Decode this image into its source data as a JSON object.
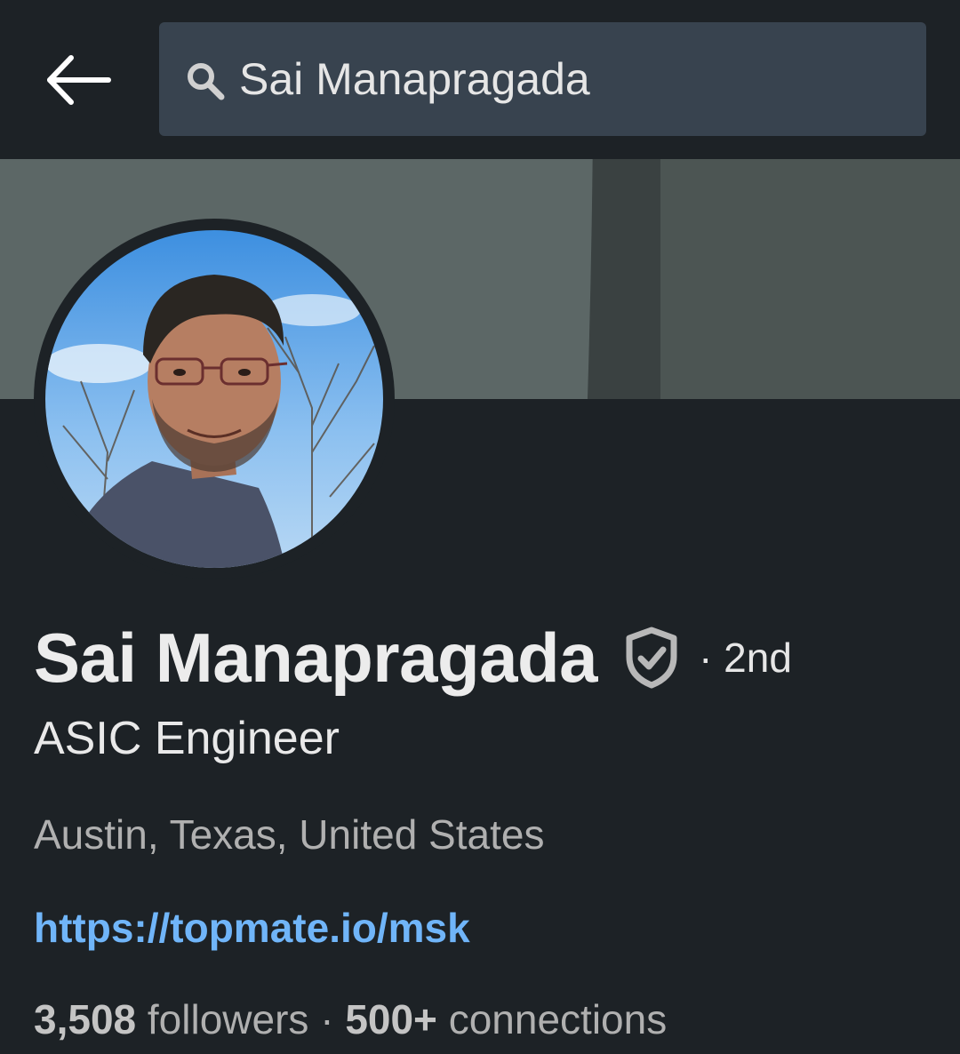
{
  "search": {
    "query": "Sai Manapragada"
  },
  "profile": {
    "name": "Sai Manapragada",
    "degree": "· 2nd",
    "headline": "ASIC Engineer",
    "location": "Austin, Texas, United States",
    "website": "https://topmate.io/msk",
    "followers_count": "3,508",
    "followers_label": "followers",
    "separator": "·",
    "connections_count": "500+",
    "connections_label": "connections"
  },
  "icons": {
    "back": "back-arrow-icon",
    "search": "search-icon",
    "verified": "verified-shield-icon"
  },
  "colors": {
    "background": "#1d2226",
    "search_box": "#38434f",
    "link": "#70b5f9",
    "cover": "#5c6766"
  }
}
